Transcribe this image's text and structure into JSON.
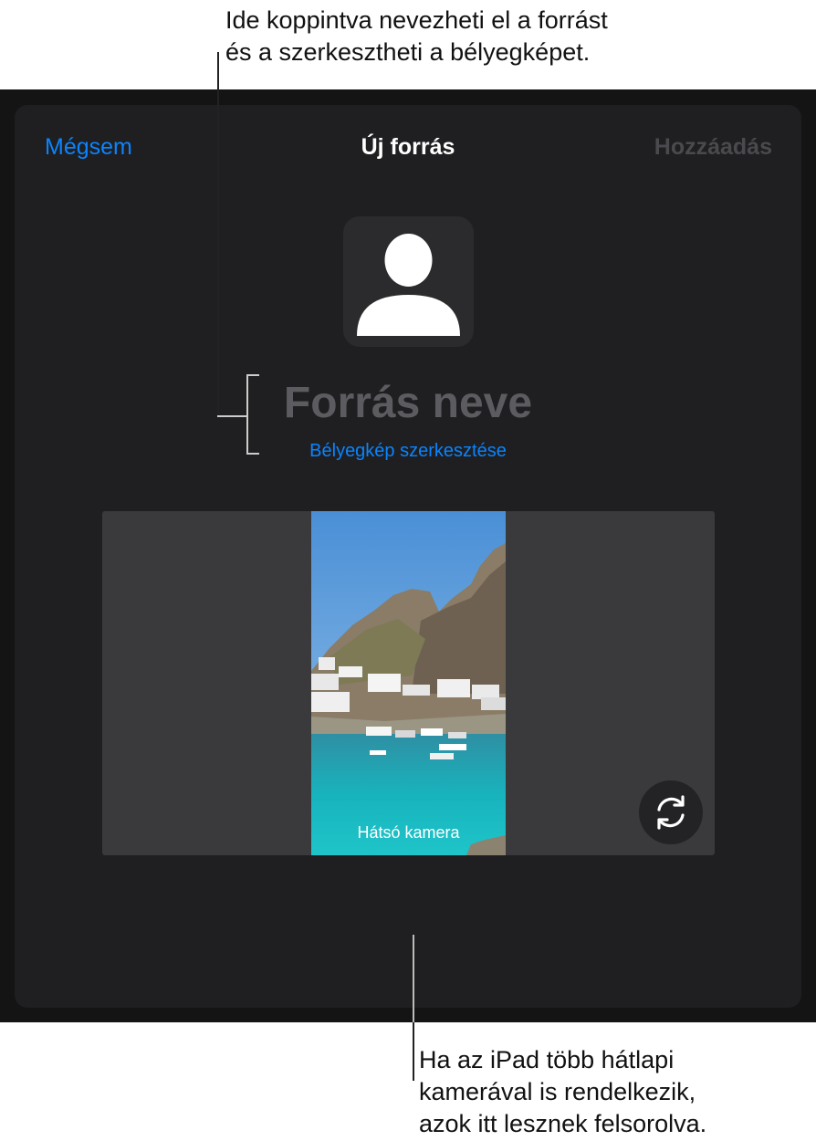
{
  "annotations": {
    "top_callout": [
      "Ide koppintva nevezheti el a forrást",
      "és a szerkesztheti a bélyegképet."
    ],
    "bottom_callout": [
      "Ha az iPad több hátlapi",
      "kamerával is rendelkezik,",
      "azok itt lesznek felsorolva."
    ]
  },
  "nav": {
    "cancel_label": "Mégsem",
    "title": "Új forrás",
    "add_label": "Hozzáadás"
  },
  "source": {
    "avatar_icon": "person-silhouette-icon",
    "name_placeholder": "Forrás neve",
    "edit_thumbnail_label": "Bélyegkép szerkesztése"
  },
  "camera": {
    "label": "Hátsó kamera",
    "switch_icon": "camera-switch-icon"
  },
  "colors": {
    "accent": "#0a84ff",
    "sheet_background": "#1f1f21",
    "disabled_text": "#4a4a4e"
  }
}
